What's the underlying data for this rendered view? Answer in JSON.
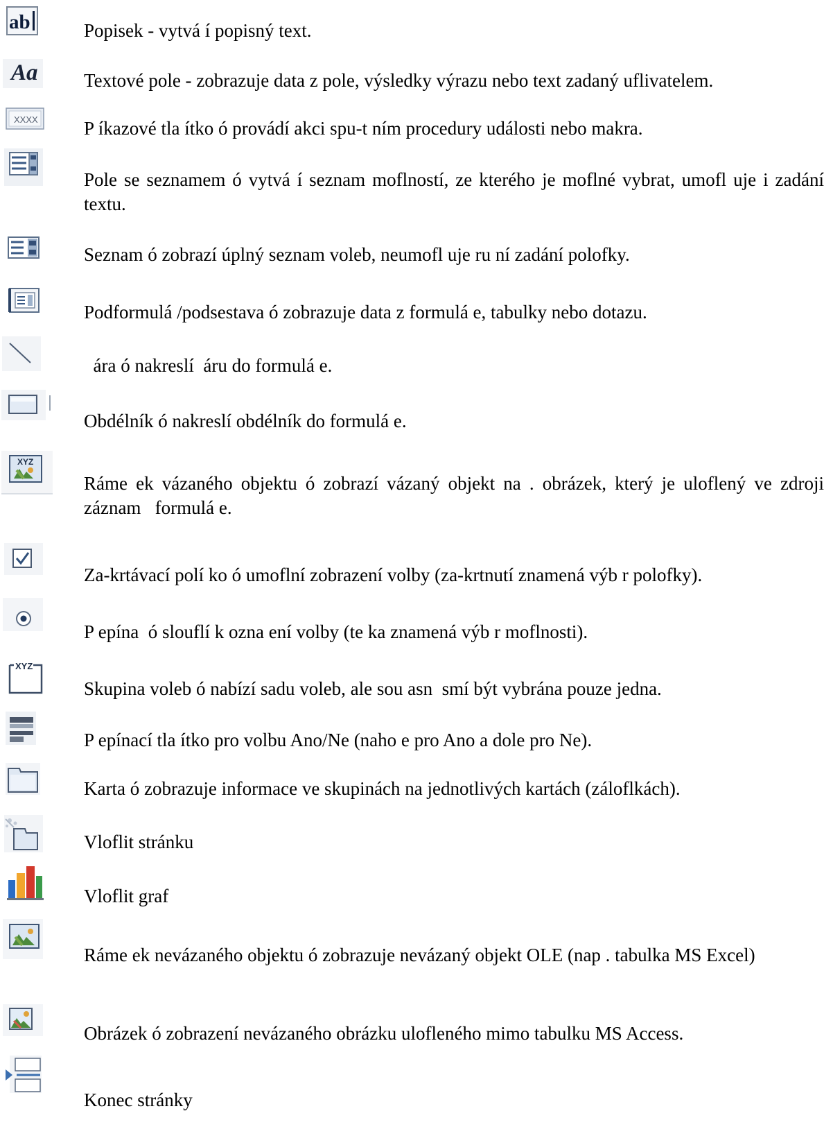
{
  "items": [
    {
      "icon": "label-tool-icon",
      "text": "Popisek - vytvá í popisný text."
    },
    {
      "icon": "text-box-tool-icon",
      "text": "Textové pole - zobrazuje data z pole, výsledky výrazu nebo text zadaný uflivatelem."
    },
    {
      "icon": "command-button-tool-icon",
      "text": "P íkazové tla ítko ó provádí akci spu-t ním procedury události nebo makra."
    },
    {
      "icon": "combo-box-tool-icon",
      "text": "Pole se seznamem ó vytvá í seznam moflností, ze kterého je moflné vybrat, umofl uje i zadání textu."
    },
    {
      "icon": "list-box-tool-icon",
      "text": "Seznam ó zobrazí úplný seznam voleb, neumofl uje ru ní zadání polofky."
    },
    {
      "icon": "subform-tool-icon",
      "text": "Podformulá /podsestava ó zobrazuje data z formulá e, tabulky nebo dotazu."
    },
    {
      "icon": "line-tool-icon",
      "text": "  ára ó nakreslí  áru do formulá e."
    },
    {
      "icon": "rectangle-tool-icon",
      "text": "Obdélník ó nakreslí obdélník do formulá e."
    },
    {
      "icon": "bound-object-frame-tool-icon",
      "text": "Ráme ek vázaného objektu ó zobrazí vázaný objekt na . obrázek, který je uloflený ve zdroji záznam   formulá e."
    },
    {
      "icon": "check-box-tool-icon",
      "text": "Za-krtávací polí ko ó umoflní zobrazení volby (za-krtnutí znamená výb r polofky)."
    },
    {
      "icon": "option-button-tool-icon",
      "text": "P epína  ó slouflí k ozna ení volby (te ka znamená výb r moflnosti)."
    },
    {
      "icon": "option-group-tool-icon",
      "text": "Skupina voleb ó nabízí sadu voleb, ale sou asn  smí být vybrána pouze jedna."
    },
    {
      "icon": "toggle-button-tool-icon",
      "text": "P epínací tla ítko pro volbu Ano/Ne (naho e pro Ano a dole pro Ne)."
    },
    {
      "icon": "tab-control-tool-icon",
      "text": "Karta ó zobrazuje informace ve skupinách na jednotlivých kartách (záloflkách)."
    },
    {
      "icon": "insert-page-tool-icon",
      "text": "Vloflit stránku"
    },
    {
      "icon": "insert-chart-tool-icon",
      "text": "Vloflit graf"
    },
    {
      "icon": "unbound-object-frame-tool-icon",
      "text": "Ráme ek nevázaného objektu ó zobrazuje nevázaný objekt OLE (nap . tabulka MS Excel)"
    },
    {
      "icon": "image-tool-icon",
      "text": "Obrázek ó zobrazení nevázaného obrázku ulofleného mimo tabulku MS Access."
    },
    {
      "icon": "page-break-tool-icon",
      "text": "Konec stránky"
    }
  ]
}
